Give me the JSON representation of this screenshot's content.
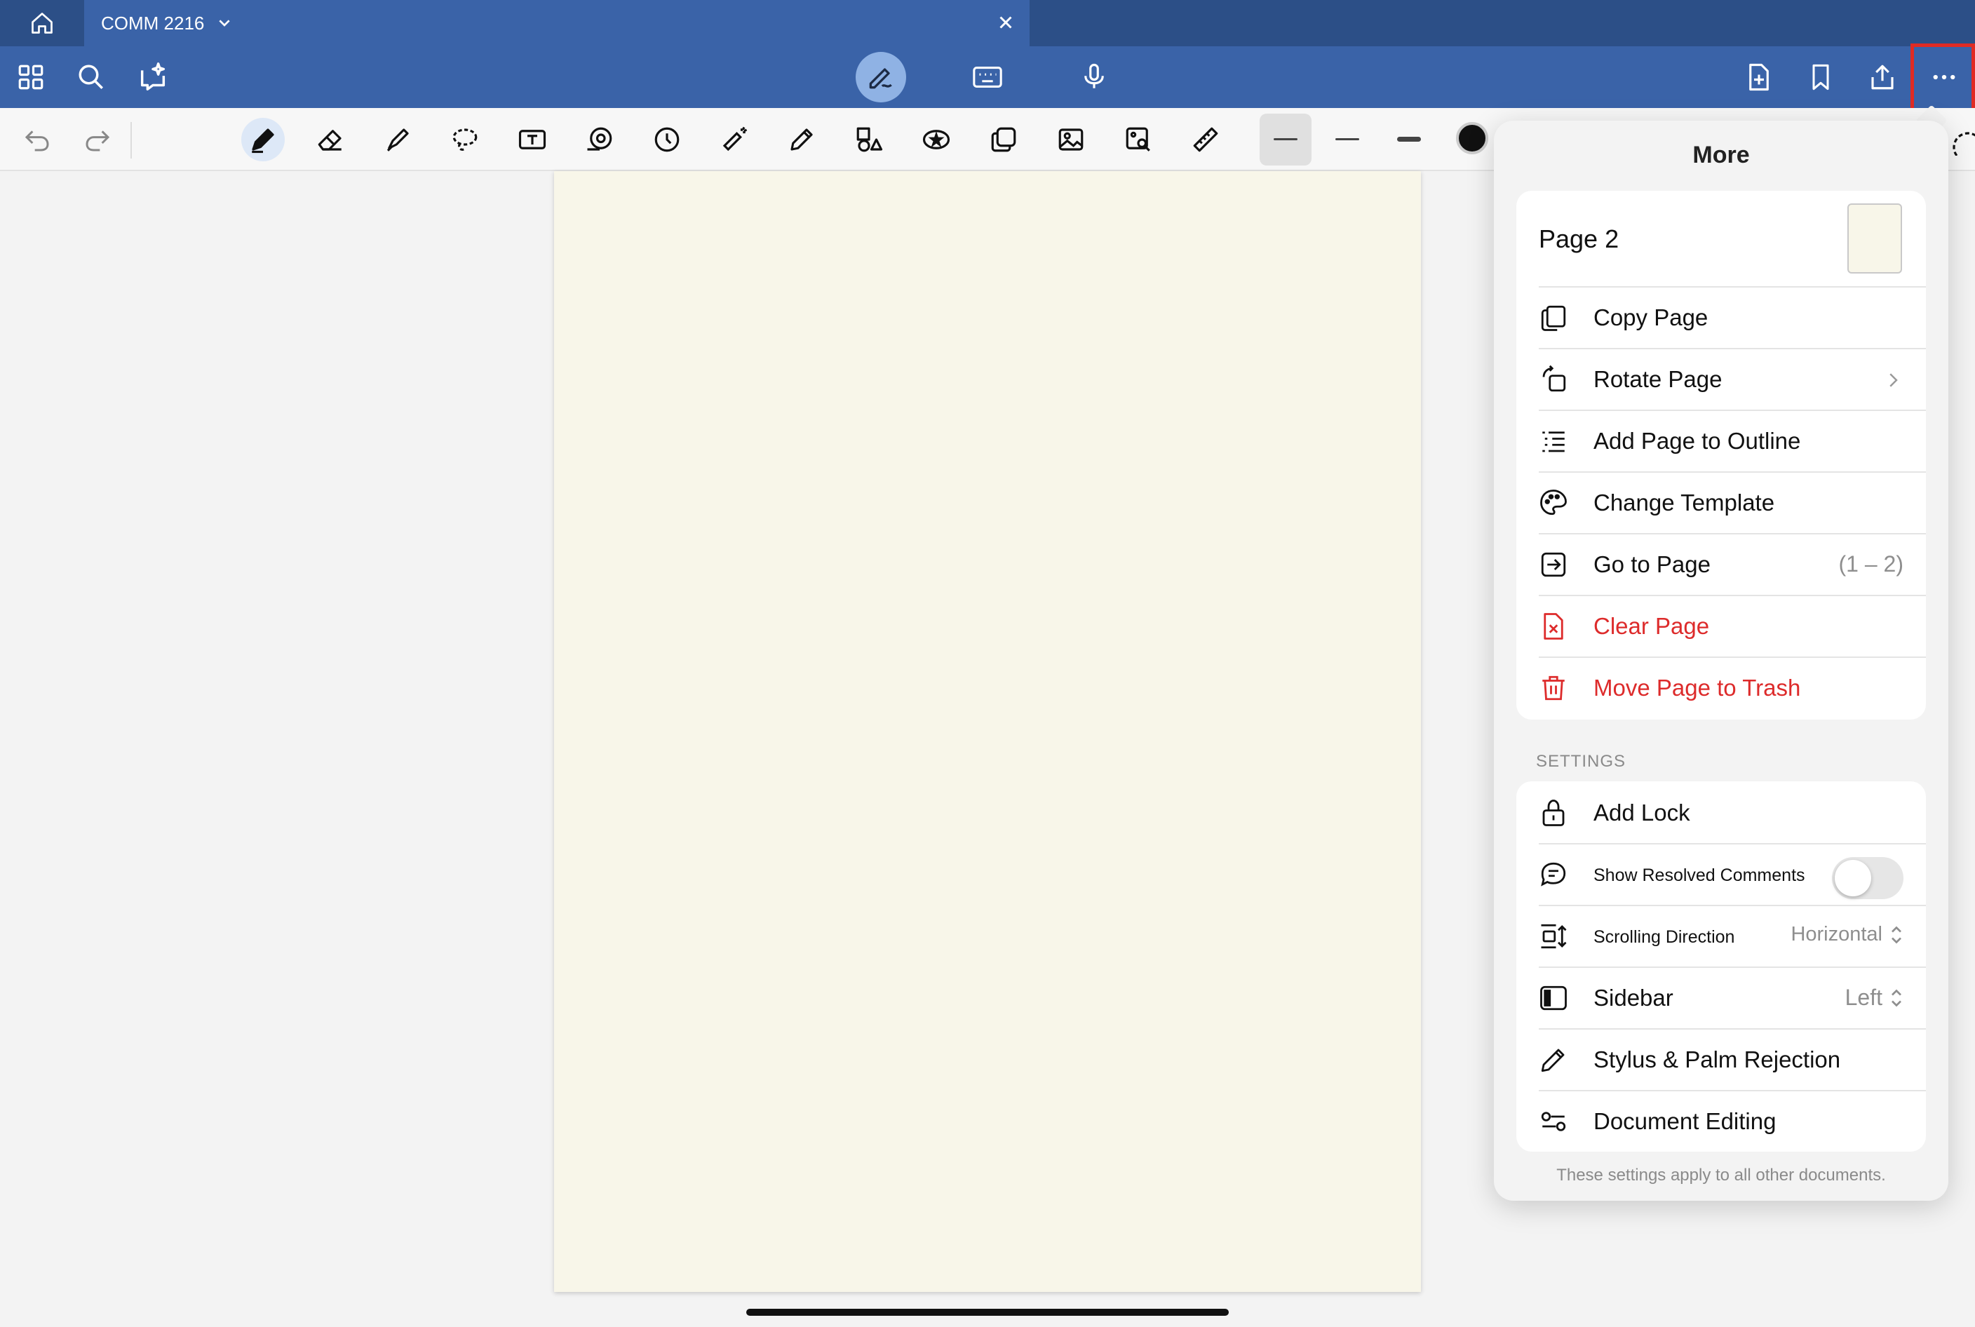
{
  "tab": {
    "title": "COMM 2216"
  },
  "popover": {
    "title": "More",
    "page_label": "Page 2",
    "actions": [
      {
        "label": "Copy Page",
        "icon": "copy-icon"
      },
      {
        "label": "Rotate Page",
        "icon": "rotate-icon"
      },
      {
        "label": "Add Page to Outline",
        "icon": "outline-icon"
      },
      {
        "label": "Change Template",
        "icon": "palette-icon"
      },
      {
        "label": "Go to Page",
        "icon": "go-to-page-icon",
        "hint": "(1 – 2)"
      },
      {
        "label": "Clear Page",
        "icon": "clear-page-icon"
      },
      {
        "label": "Move Page to Trash",
        "icon": "trash-icon"
      }
    ],
    "settings_title": "SETTINGS",
    "settings": [
      {
        "label": "Add Lock",
        "icon": "lock-icon"
      },
      {
        "label": "Show Resolved Comments",
        "icon": "comment-icon",
        "toggle": false
      },
      {
        "label": "Scrolling Direction",
        "icon": "scroll-direction-icon",
        "value": "Horizontal"
      },
      {
        "label": "Sidebar",
        "icon": "sidebar-icon",
        "value": "Left"
      },
      {
        "label": "Stylus & Palm Rejection",
        "icon": "stylus-icon"
      },
      {
        "label": "Document Editing",
        "icon": "sliders-icon"
      }
    ],
    "footer": "These settings apply to all other documents."
  },
  "colors": {
    "nav_blue": "#3a63a8",
    "tab_blue": "#2c4f87",
    "danger_red": "#dd2b2b",
    "page": "#f8f6e9"
  }
}
